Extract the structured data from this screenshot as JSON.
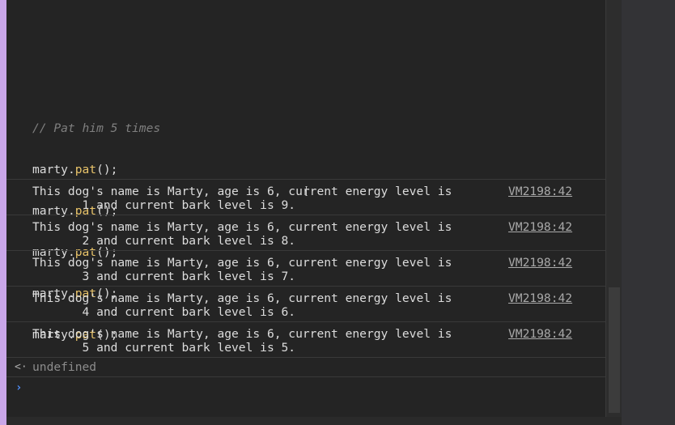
{
  "code": {
    "comment": "// Pat him 5 times",
    "lines": [
      {
        "object": "marty",
        "dot": ".",
        "method": "pat",
        "args": "();"
      },
      {
        "object": "marty",
        "dot": ".",
        "method": "pat",
        "args": "();"
      },
      {
        "object": "marty",
        "dot": ".",
        "method": "pat",
        "args": "();"
      },
      {
        "object": "marty",
        "dot": ".",
        "method": "pat",
        "args": "();"
      },
      {
        "object": "marty",
        "dot": ".",
        "method": "pat",
        "args": "();"
      }
    ]
  },
  "logs": [
    {
      "line1": "This dog's name is Marty, age is 6, current energy level is",
      "line2": "       1 and current bark level is 9.",
      "source": "VM2198:42"
    },
    {
      "line1": "This dog's name is Marty, age is 6, current energy level is",
      "line2": "       2 and current bark level is 8.",
      "source": "VM2198:42"
    },
    {
      "line1": "This dog's name is Marty, age is 6, current energy level is",
      "line2": "       3 and current bark level is 7.",
      "source": "VM2198:42"
    },
    {
      "line1": "This dog's name is Marty, age is 6, current energy level is",
      "line2": "       4 and current bark level is 6.",
      "source": "VM2198:42"
    },
    {
      "line1": "This dog's name is Marty, age is 6, current energy level is",
      "line2": "       5 and current bark level is 5.",
      "source": "VM2198:42"
    }
  ],
  "result": {
    "arrow_glyph": "<·",
    "value": "undefined"
  },
  "prompt": {
    "glyph": "›",
    "input_value": ""
  },
  "colors": {
    "method": "#e9c46a",
    "comment": "#7f7f7f",
    "prompt": "#4f8ef7",
    "accent_strip": "#c9a6e8"
  },
  "icons": {
    "result": "return-value-icon",
    "prompt": "console-prompt-icon",
    "cursor": "text-cursor-icon"
  }
}
